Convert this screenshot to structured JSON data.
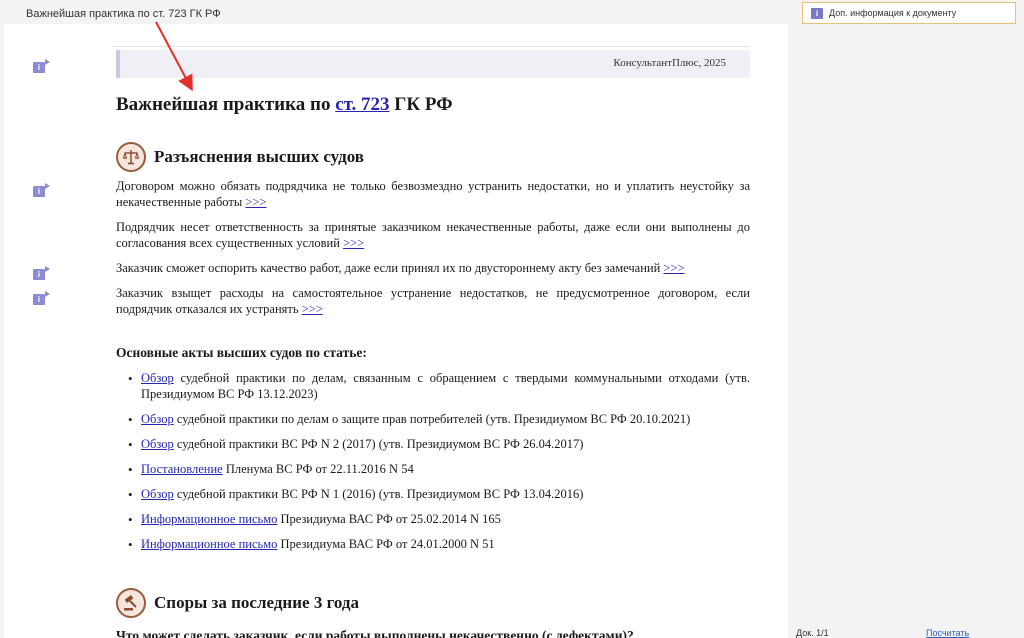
{
  "tab": {
    "title": "Важнейшая практика по ст. 723 ГК РФ"
  },
  "right_panel": {
    "info_label": "Доп. информация к документу",
    "badge": "i"
  },
  "footer": {
    "doc_counter": "Док. 1/1",
    "link": "Посчитать"
  },
  "doc": {
    "brand": "КонсультантПлюс, 2025",
    "title_pre": "Важнейшая практика по ",
    "title_link": "ст. 723",
    "title_post": " ГК РФ",
    "section1": {
      "title": "Разъяснения высших судов",
      "icon": "scales-icon"
    },
    "paragraphs": [
      {
        "text": "Договором можно обязать подрядчика не только безвозмездно устранить недостатки, но и уплатить неустойку за некачественные работы ",
        "link": ">>>"
      },
      {
        "text": "Подрядчик несет ответственность за принятые заказчиком некачественные работы, даже если они выполнены до согласования всех существенных условий ",
        "link": ">>>"
      },
      {
        "text": "Заказчик сможет оспорить качество работ, даже если принял их по двустороннему акту без замечаний ",
        "link": ">>>"
      },
      {
        "text": "Заказчик взыщет расходы на самостоятельное устранение недостатков, не предусмотренное договором, если подрядчик отказался их устранять ",
        "link": ">>>"
      }
    ],
    "acts_heading": "Основные акты высших судов по статье:",
    "acts": [
      {
        "link": "Обзор",
        "text": " судебной практики по делам, связанным с обращением с твердыми коммунальными отходами (утв. Президиумом ВС РФ 13.12.2023)"
      },
      {
        "link": "Обзор",
        "text": " судебной практики по делам о защите прав потребителей (утв. Президиумом ВС РФ 20.10.2021)"
      },
      {
        "link": "Обзор",
        "text": " судебной практики ВС РФ N 2 (2017) (утв. Президиумом ВС РФ 26.04.2017)"
      },
      {
        "link": "Постановление",
        "text": " Пленума ВС РФ от 22.11.2016 N 54"
      },
      {
        "link": "Обзор",
        "text": " судебной практики ВС РФ N 1 (2016) (утв. Президиумом ВС РФ 13.04.2016)"
      },
      {
        "link": "Информационное письмо",
        "text": " Президиума ВАС РФ от 25.02.2014 N 165"
      },
      {
        "link": "Информационное письмо",
        "text": " Президиума ВАС РФ от 24.01.2000 N 51"
      }
    ],
    "section2": {
      "title": "Споры за последние 3 года",
      "icon": "gavel-icon"
    },
    "question": "Что может сделать заказчик, если работы выполнены некачественно (с дефектами)?"
  },
  "colors": {
    "link": "#2626b0",
    "badge": "#7b79c7",
    "arrow": "#e0322b",
    "info_border": "#e6c277"
  }
}
